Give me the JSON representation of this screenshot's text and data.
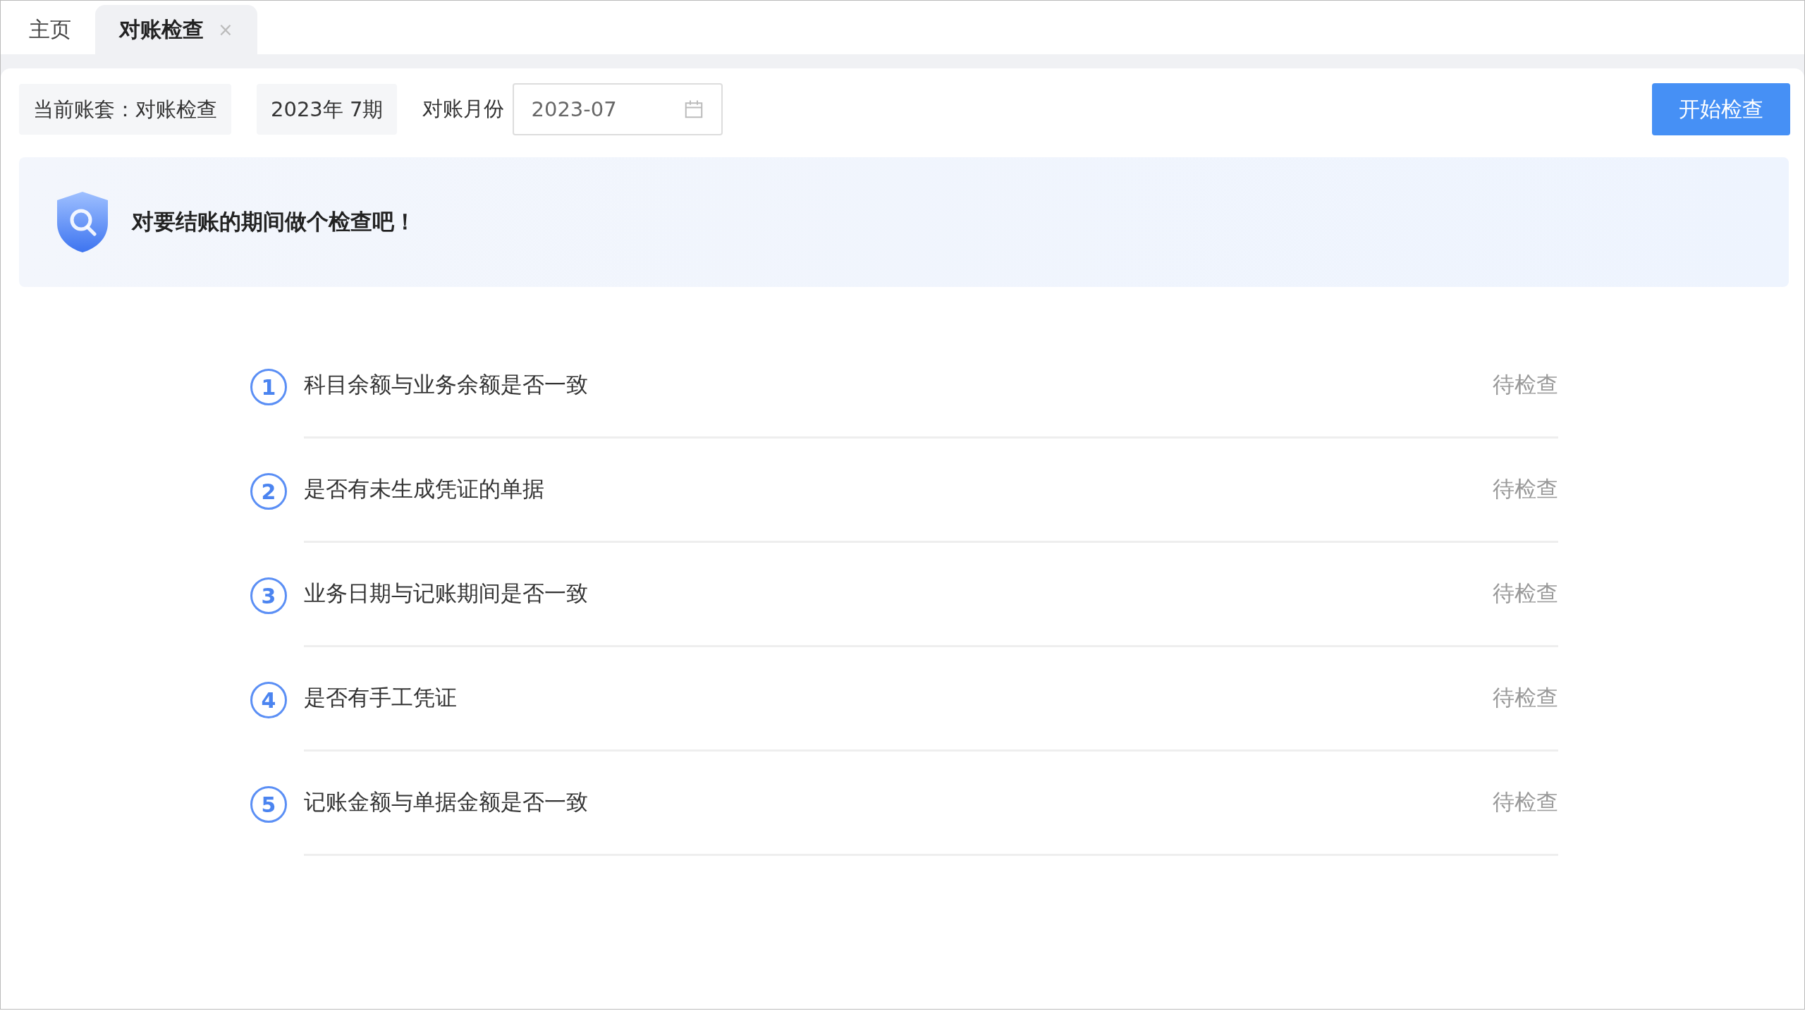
{
  "tabs": [
    {
      "label": "主页",
      "selected": false
    },
    {
      "label": "对账检查",
      "selected": true,
      "close_glyph": "×"
    }
  ],
  "toolbar": {
    "account_label": "当前账套：对账检查",
    "period": "2023年 7期",
    "month_label": "对账月份",
    "month_value": "2023-07",
    "start_button": "开始检查"
  },
  "banner": {
    "text": "对要结账的期间做个检查吧！"
  },
  "checks": [
    {
      "number": "1",
      "title": "科目余额与业务余额是否一致",
      "status": "待检查"
    },
    {
      "number": "2",
      "title": "是否有未生成凭证的单据",
      "status": "待检查"
    },
    {
      "number": "3",
      "title": "业务日期与记账期间是否一致",
      "status": "待检查"
    },
    {
      "number": "4",
      "title": "是否有手工凭证",
      "status": "待检查"
    },
    {
      "number": "5",
      "title": "记账金额与单据金额是否一致",
      "status": "待检查"
    }
  ]
}
